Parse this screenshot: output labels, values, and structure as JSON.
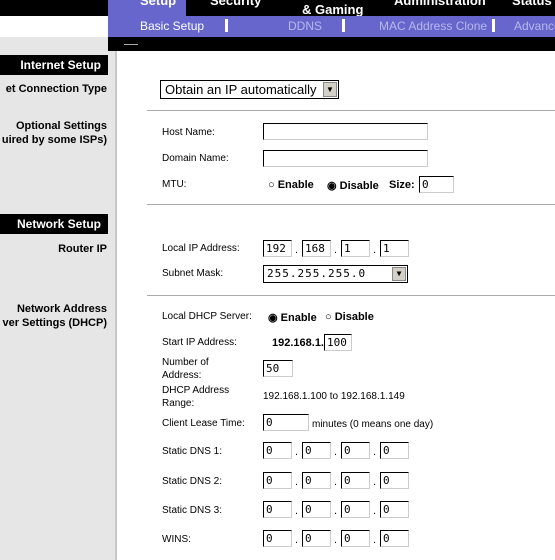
{
  "top_tabs": [
    "Setup",
    "Security",
    "& Gaming",
    "Administration",
    "Status"
  ],
  "sub_tabs": [
    "Basic Setup",
    "DDNS",
    "MAC Address Clone",
    "Advance"
  ],
  "sections": {
    "internet": "Internet Setup",
    "network": "Network Setup"
  },
  "left_labels": {
    "connection_type": "et Connection Type",
    "optional1": "Optional Settings",
    "optional2": "uired by some ISPs)",
    "router_ip": "Router IP",
    "dhcp1": "Network Address",
    "dhcp2": "ver Settings (DHCP)"
  },
  "connection_type": "Obtain an IP automatically",
  "host_name": {
    "label": "Host Name:",
    "value": ""
  },
  "domain_name": {
    "label": "Domain Name:",
    "value": ""
  },
  "mtu": {
    "label": "MTU:",
    "enable": "Enable",
    "disable": "Disable",
    "size_label": "Size:",
    "size": "0",
    "selected": "Disable"
  },
  "local_ip": {
    "label": "Local IP Address:",
    "octets": [
      "192",
      "168",
      "1",
      "1"
    ]
  },
  "subnet": {
    "label": "Subnet Mask:",
    "value": "255.255.255.0"
  },
  "dhcp": {
    "label": "Local DHCP Server:",
    "enable": "Enable",
    "disable": "Disable",
    "selected": "Enable"
  },
  "start_ip": {
    "label": "Start IP Address:",
    "prefix": "192.168.1.",
    "value": "100"
  },
  "number": {
    "label1": "Number  of",
    "label2": "Address:",
    "value": "50"
  },
  "range": {
    "label1": "DHCP  Address",
    "label2": "Range:",
    "value": "192.168.1.100  to  192.168.1.149"
  },
  "lease": {
    "label": "Client Lease Time:",
    "value": "0",
    "suffix": "minutes (0 means one day)"
  },
  "dns": [
    {
      "label": "Static DNS 1:",
      "octets": [
        "0",
        "0",
        "0",
        "0"
      ]
    },
    {
      "label": "Static DNS 2:",
      "octets": [
        "0",
        "0",
        "0",
        "0"
      ]
    },
    {
      "label": "Static DNS 3:",
      "octets": [
        "0",
        "0",
        "0",
        "0"
      ]
    },
    {
      "label": "WINS:",
      "octets": [
        "0",
        "0",
        "0",
        "0"
      ]
    }
  ],
  "colors": {
    "accent": "#6666cc",
    "header": "#000000",
    "panel": "#e6e6e6"
  }
}
